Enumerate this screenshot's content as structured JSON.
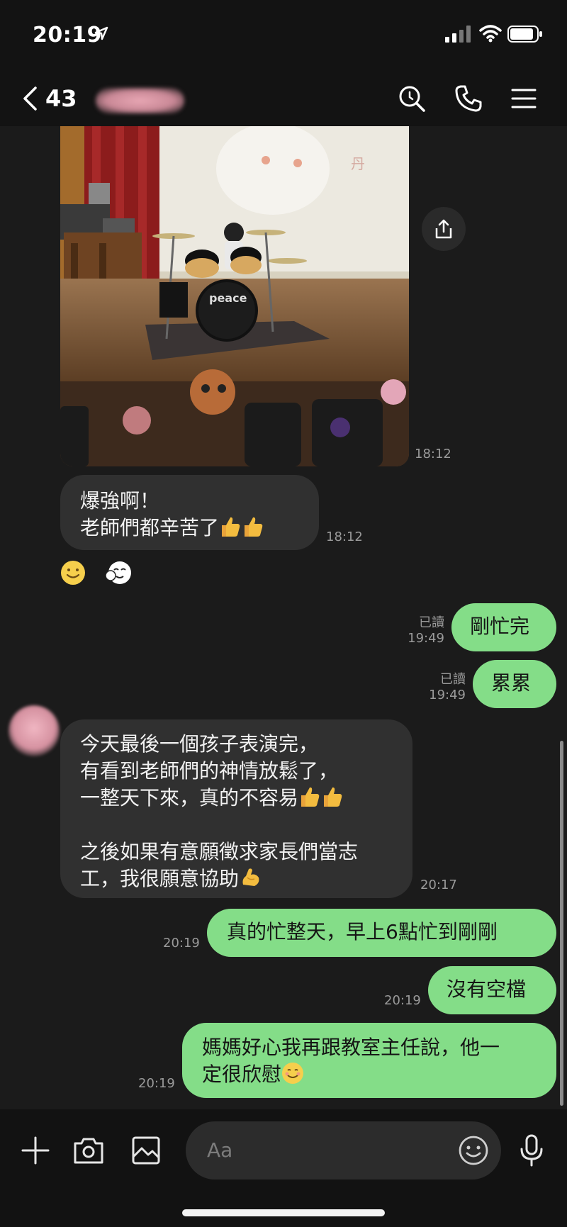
{
  "status": {
    "time": "20:19"
  },
  "header": {
    "member_count": "43"
  },
  "messages": {
    "photo_time": "18:12",
    "m1_line1": "爆強啊！",
    "m1_line2": "老師們都辛苦了",
    "m1_time": "18:12",
    "o1_text": "剛忙完",
    "o1_read": "已讀",
    "o1_time": "19:49",
    "o2_text": "累累",
    "o2_read": "已讀",
    "o2_time": "19:49",
    "m2_line1": "今天最後一個孩子表演完，",
    "m2_line2": "有看到老師們的神情放鬆了，",
    "m2_line3": "一整天下來，真的不容易",
    "m2_line4": "之後如果有意願徵求家長們當志",
    "m2_line5": "工，我很願意協助",
    "m2_time": "20:17",
    "o3_text": "真的忙整天，早上6點忙到剛剛",
    "o3_time": "20:19",
    "o4_text": "沒有空檔",
    "o4_time": "20:19",
    "o5_line1": "媽媽好心我再跟教室主任說，他一",
    "o5_line2": "定很欣慰",
    "o5_time": "20:19"
  },
  "input": {
    "placeholder": "Aa"
  },
  "icons": {
    "header": [
      "back-chevron",
      "search",
      "phone",
      "menu"
    ],
    "bottom": [
      "plus",
      "camera",
      "image",
      "emoji",
      "microphone"
    ],
    "reactions": [
      "smile",
      "sticker"
    ]
  },
  "colors": {
    "outgoing_bubble": "#84dd88",
    "incoming_bubble": "#303030",
    "background": "#1b1b1b"
  }
}
